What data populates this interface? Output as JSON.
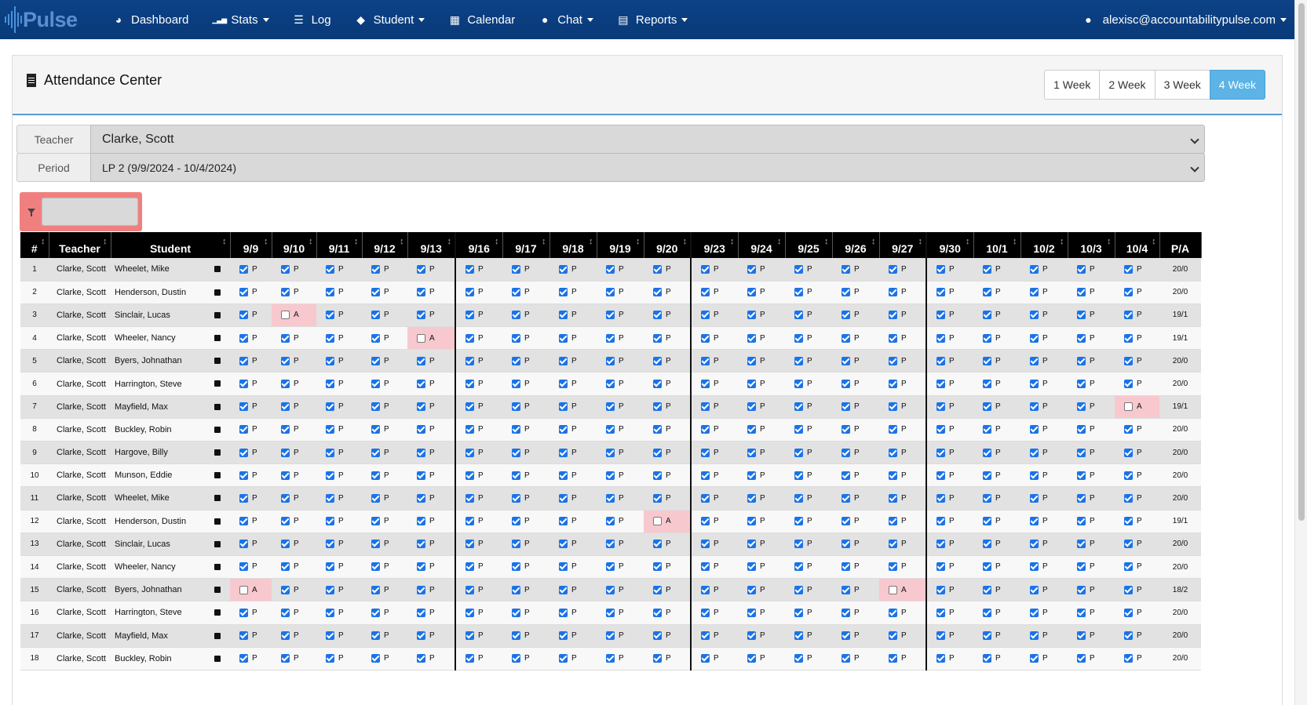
{
  "nav": {
    "logo_text": "Pulse",
    "items": [
      {
        "label": "Dashboard",
        "icon": "dashboard-icon",
        "caret": false
      },
      {
        "label": "Stats",
        "icon": "bar-chart-icon",
        "caret": true
      },
      {
        "label": "Log",
        "icon": "list-icon",
        "caret": false
      },
      {
        "label": "Student",
        "icon": "graduation-cap-icon",
        "caret": true
      },
      {
        "label": "Calendar",
        "icon": "calendar-icon",
        "caret": false
      },
      {
        "label": "Chat",
        "icon": "chat-icon",
        "caret": true
      },
      {
        "label": "Reports",
        "icon": "document-icon",
        "caret": true
      }
    ],
    "user_email": "alexisc@accountabilitypulse.com"
  },
  "panel": {
    "title": "Attendance Center",
    "weeks": [
      "1 Week",
      "2 Week",
      "3 Week",
      "4 Week"
    ],
    "active_week": "4 Week"
  },
  "filters": {
    "teacher_label": "Teacher",
    "teacher_value": "Clarke, Scott",
    "period_label": "Period",
    "period_value": "LP 2 (9/9/2024 - 10/4/2024)"
  },
  "table": {
    "headers": {
      "num": "#",
      "teacher": "Teacher",
      "student": "Student",
      "pa": "P/A"
    },
    "dates": [
      "9/9",
      "9/10",
      "9/11",
      "9/12",
      "9/13",
      "9/16",
      "9/17",
      "9/18",
      "9/19",
      "9/20",
      "9/23",
      "9/24",
      "9/25",
      "9/26",
      "9/27",
      "9/30",
      "10/1",
      "10/2",
      "10/3",
      "10/4"
    ],
    "rows": [
      {
        "num": "1",
        "teacher": "Clarke, Scott",
        "student": "Wheelet, Mike",
        "marks": "PPPPPPPPPPPPPPPPPPPP",
        "pa": "20/0"
      },
      {
        "num": "2",
        "teacher": "Clarke, Scott",
        "student": "Henderson, Dustin",
        "marks": "PPPPPPPPPPPPPPPPPPPP",
        "pa": "20/0"
      },
      {
        "num": "3",
        "teacher": "Clarke, Scott",
        "student": "Sinclair, Lucas",
        "marks": "PAPPPPPPPPPPPPPPPPPP",
        "pa": "19/1"
      },
      {
        "num": "4",
        "teacher": "Clarke, Scott",
        "student": "Wheeler, Nancy",
        "marks": "PPPPAPPPPPPPPPPPPPPP",
        "pa": "19/1"
      },
      {
        "num": "5",
        "teacher": "Clarke, Scott",
        "student": "Byers, Johnathan",
        "marks": "PPPPPPPPPPPPPPPPPPPP",
        "pa": "20/0"
      },
      {
        "num": "6",
        "teacher": "Clarke, Scott",
        "student": "Harrington, Steve",
        "marks": "PPPPPPPPPPPPPPPPPPPP",
        "pa": "20/0"
      },
      {
        "num": "7",
        "teacher": "Clarke, Scott",
        "student": "Mayfield, Max",
        "marks": "PPPPPPPPPPPPPPPPPPPA",
        "pa": "19/1"
      },
      {
        "num": "8",
        "teacher": "Clarke, Scott",
        "student": "Buckley, Robin",
        "marks": "PPPPPPPPPPPPPPPPPPPP",
        "pa": "20/0"
      },
      {
        "num": "9",
        "teacher": "Clarke, Scott",
        "student": "Hargove, Billy",
        "marks": "PPPPPPPPPPPPPPPPPPPP",
        "pa": "20/0"
      },
      {
        "num": "10",
        "teacher": "Clarke, Scott",
        "student": "Munson, Eddie",
        "marks": "PPPPPPPPPPPPPPPPPPPP",
        "pa": "20/0"
      },
      {
        "num": "11",
        "teacher": "Clarke, Scott",
        "student": "Wheelet, Mike",
        "marks": "PPPPPPPPPPPPPPPPPPPP",
        "pa": "20/0"
      },
      {
        "num": "12",
        "teacher": "Clarke, Scott",
        "student": "Henderson, Dustin",
        "marks": "PPPPPPPPPAPPPPPPPPPP",
        "pa": "19/1"
      },
      {
        "num": "13",
        "teacher": "Clarke, Scott",
        "student": "Sinclair, Lucas",
        "marks": "PPPPPPPPPPPPPPPPPPPP",
        "pa": "20/0"
      },
      {
        "num": "14",
        "teacher": "Clarke, Scott",
        "student": "Wheeler, Nancy",
        "marks": "PPPPPPPPPPPPPPPPPPPP",
        "pa": "20/0"
      },
      {
        "num": "15",
        "teacher": "Clarke, Scott",
        "student": "Byers, Johnathan",
        "marks": "APPPPPPPPPPPPPAPPPPP",
        "pa": "18/2"
      },
      {
        "num": "16",
        "teacher": "Clarke, Scott",
        "student": "Harrington, Steve",
        "marks": "PPPPPPPPPPPPPPPPPPPP",
        "pa": "20/0"
      },
      {
        "num": "17",
        "teacher": "Clarke, Scott",
        "student": "Mayfield, Max",
        "marks": "PPPPPPPPPPPPPPPPPPPP",
        "pa": "20/0"
      },
      {
        "num": "18",
        "teacher": "Clarke, Scott",
        "student": "Buckley, Robin",
        "marks": "PPPPPPPPPPPPPPPPPPPP",
        "pa": "20/0"
      }
    ]
  }
}
